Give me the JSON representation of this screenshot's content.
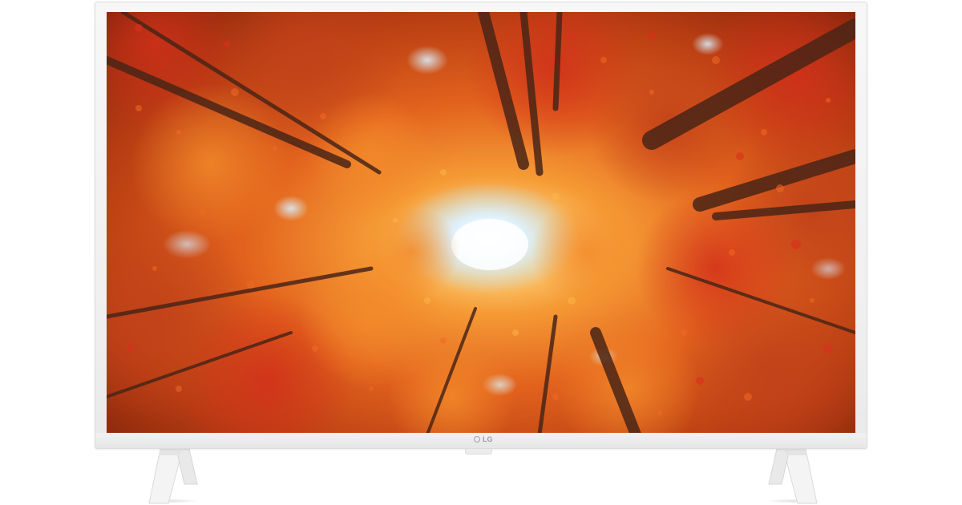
{
  "product": {
    "brand_logo_text": "LG",
    "frame_color": "#f3f3f3",
    "screen_scene": "autumn-forest-canopy",
    "screen_colors": {
      "deep_red": "#8e2a0b",
      "orange": "#e8621c",
      "bright_orange": "#f8a03a",
      "sky": "#bfe0f5",
      "trunk": "#4a2a1a"
    }
  }
}
